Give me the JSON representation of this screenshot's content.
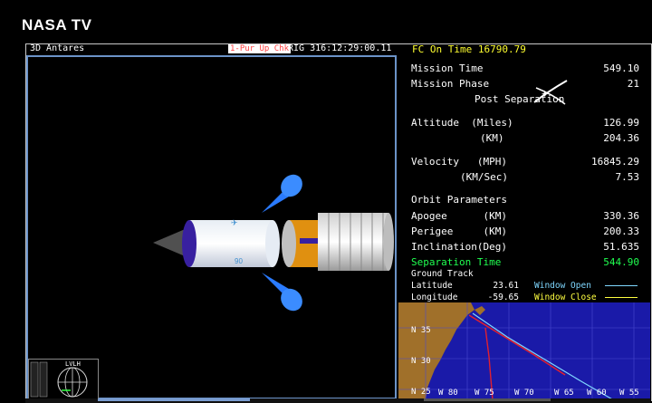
{
  "brand": "NASA TV",
  "header": {
    "view_label": "3D Antares",
    "flag_label": "1-Pur Up Chk",
    "clock": "RIG 316:12:29:00.11",
    "fc_on_time": "FC On Time 16790.79"
  },
  "telemetry": {
    "mission_time_label": "Mission Time",
    "mission_time": "549.10",
    "mission_phase_label": "Mission Phase",
    "mission_phase": "21",
    "phase_name": "Post Separation",
    "altitude_label": "Altitude  (Miles)",
    "altitude_miles": "126.99",
    "altitude_km_label": "(KM)",
    "altitude_km": "204.36",
    "velocity_label": "Velocity   (MPH)",
    "velocity_mph": "16845.29",
    "velocity_kms_label": "(KM/Sec)",
    "velocity_kms": "7.53",
    "orbit_header": "Orbit Parameters",
    "apogee_label": "Apogee      (KM)",
    "apogee": "330.36",
    "perigee_label": "Perigee     (KM)",
    "perigee": "200.33",
    "inclination_label": "Inclination(Deg)",
    "inclination": "51.635",
    "separation_label": "Separation Time",
    "separation_time": "544.90",
    "ground_track_label": "Ground Track",
    "latitude_label": "Latitude",
    "latitude": "23.61",
    "longitude_label": "Longitude",
    "longitude": "-59.65",
    "window_open_label": "Window Open",
    "window_close_label": "Window Close"
  },
  "map": {
    "lat_labels": [
      "N 35",
      "N 30",
      "N 25"
    ],
    "lon_labels": [
      "W 80",
      "W 75",
      "W 70",
      "W 65",
      "W 60",
      "W 55"
    ]
  },
  "attitude": {
    "label": "LVLH"
  },
  "colors": {
    "window_open": "#7fd7ff",
    "window_close": "#ffff40",
    "separation": "#20ff50",
    "map_ocean": "#1a1aa8",
    "map_land": "#a0702a"
  }
}
